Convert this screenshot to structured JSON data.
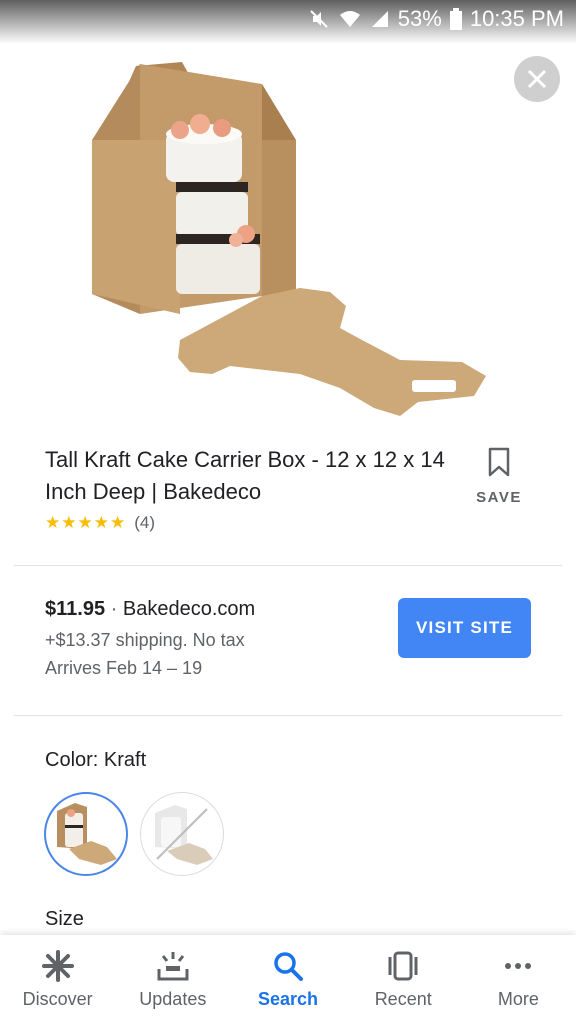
{
  "status_bar": {
    "battery": "53%",
    "time": "10:35 PM"
  },
  "product": {
    "title": "Tall Kraft Cake Carrier Box - 12 x 12 x 14 Inch Deep | Bakedeco",
    "save_label": "SAVE",
    "stars": "★★★★★",
    "rating_value": 5,
    "review_count": "(4)"
  },
  "offer": {
    "price": "$11.95",
    "separator": "·",
    "seller": "Bakedeco.com",
    "shipping": "+$13.37 shipping. No tax",
    "arrives": "Arrives Feb 14 – 19",
    "visit_label": "VISIT SITE"
  },
  "options": {
    "color_label": "Color:",
    "color_value": "Kraft",
    "size_label": "Size"
  },
  "bottom_nav": [
    {
      "label": "Discover",
      "icon": "asterisk-icon"
    },
    {
      "label": "Updates",
      "icon": "updates-tray-icon"
    },
    {
      "label": "Search",
      "icon": "search-icon"
    },
    {
      "label": "Recent",
      "icon": "recent-cards-icon"
    },
    {
      "label": "More",
      "icon": "more-dots-icon"
    }
  ],
  "colors": {
    "accent": "#4285f4",
    "nav_active": "#1a73e8",
    "star": "#fbbc04",
    "kraft": "#c9a77a"
  }
}
